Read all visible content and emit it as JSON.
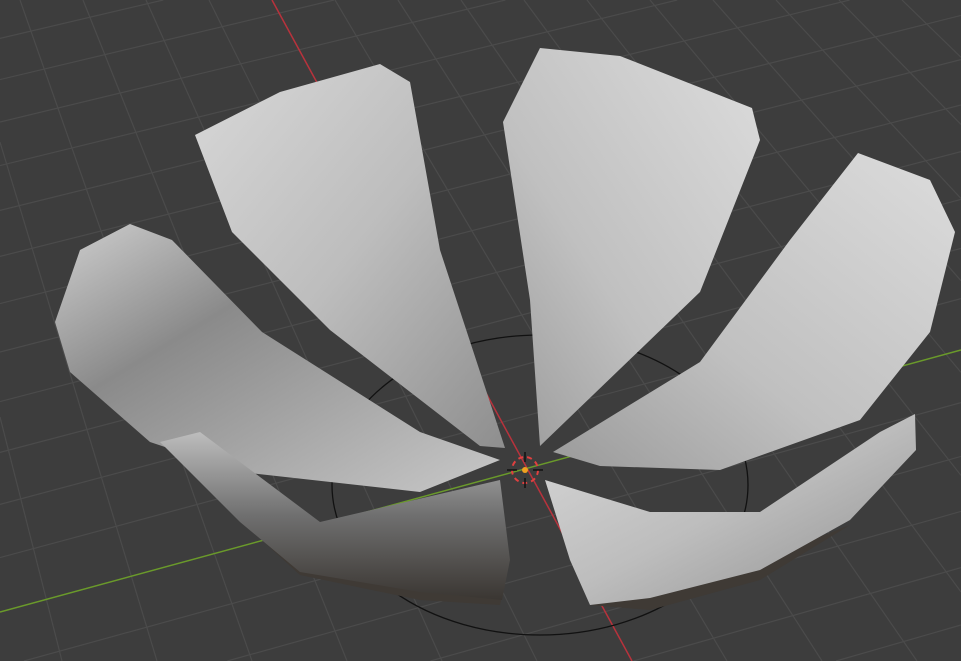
{
  "viewport": {
    "background_color": "#3d3d3d",
    "grid_color": "#4b4b4b",
    "x_axis_color": "#b8323c",
    "y_axis_color": "#6a9a2a",
    "petal_light": "#d6d6d6",
    "petal_dark": "#7c7c7c",
    "cursor_icon": "3d-cursor-icon",
    "origin_icon": "object-origin-icon"
  }
}
